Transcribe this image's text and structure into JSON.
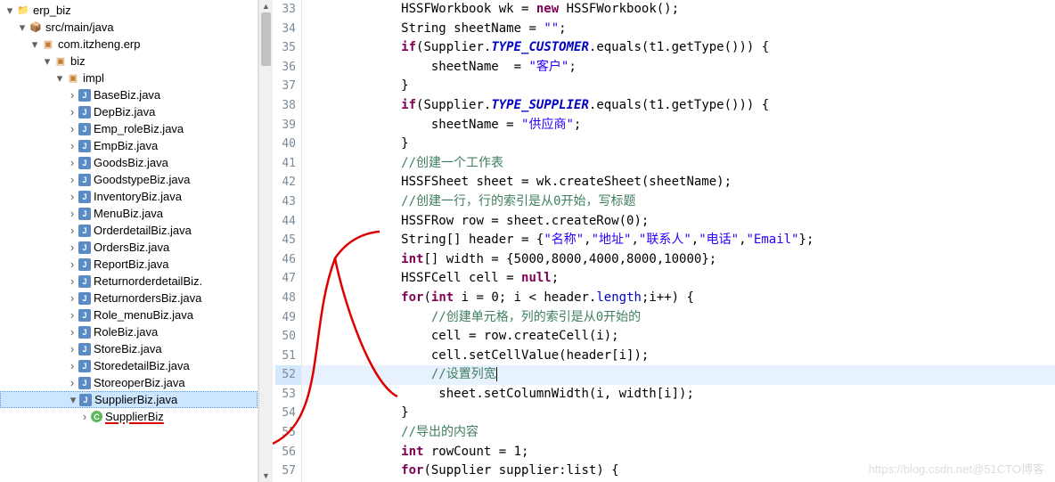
{
  "tree": {
    "root": "erp_biz",
    "src": "src/main/java",
    "pkg": "com.itzheng.erp",
    "biz": "biz",
    "impl": "impl",
    "files": [
      "BaseBiz.java",
      "DepBiz.java",
      "Emp_roleBiz.java",
      "EmpBiz.java",
      "GoodsBiz.java",
      "GoodstypeBiz.java",
      "InventoryBiz.java",
      "MenuBiz.java",
      "OrderdetailBiz.java",
      "OrdersBiz.java",
      "ReportBiz.java",
      "ReturnorderdetailBiz.",
      "ReturnordersBiz.java",
      "Role_menuBiz.java",
      "RoleBiz.java",
      "StoreBiz.java",
      "StoredetailBiz.java",
      "StoreoperBiz.java",
      "SupplierBiz.java"
    ],
    "class": "SupplierBiz"
  },
  "lines": {
    "start": 33,
    "highlight": 52
  },
  "code": {
    "l33": {
      "p1": "HSSFWorkbook wk = ",
      "kw": "new",
      "p2": " HSSFWorkbook();"
    },
    "l34": {
      "p1": "String sheetName = ",
      "s": "\"\"",
      "p2": ";"
    },
    "l35": {
      "kw": "if",
      "p1": "(Supplier.",
      "c": "TYPE_CUSTOMER",
      "p2": ".equals(t1.getType())) {"
    },
    "l36": {
      "p1": "    sheetName  = ",
      "s": "\"客户\"",
      "p2": ";"
    },
    "l37": {
      "p1": "}"
    },
    "l38": {
      "kw": "if",
      "p1": "(Supplier.",
      "c": "TYPE_SUPPLIER",
      "p2": ".equals(t1.getType())) {"
    },
    "l39": {
      "p1": "    sheetName = ",
      "s": "\"供应商\"",
      "p2": ";"
    },
    "l40": {
      "p1": "}"
    },
    "l41": {
      "cmt": "//创建一个工作表"
    },
    "l42": {
      "p1": "HSSFSheet sheet = wk.createSheet(sheetName);"
    },
    "l43": {
      "cmt": "//创建一行，行的索引是从0开始，写标题"
    },
    "l44": {
      "p1": "HSSFRow row = sheet.createRow(",
      "n": "0",
      "p2": ");"
    },
    "l45": {
      "p1": "String[] header = {",
      "s1": "\"名称\"",
      "c1": ",",
      "s2": "\"地址\"",
      "c2": ",",
      "s3": "\"联系人\"",
      "c3": ",",
      "s4": "\"电话\"",
      "c4": ",",
      "s5": "\"Email\"",
      "p2": "};"
    },
    "l46": {
      "kw": "int",
      "p1": "[] width = {",
      "n": "5000,8000,4000,8000,10000",
      "p2": "};"
    },
    "l47": {
      "p1": "HSSFCell cell = ",
      "kw": "null",
      "p2": ";"
    },
    "l48": {
      "kw1": "for",
      "p1": "(",
      "kw2": "int",
      "p2": " i = ",
      "n1": "0",
      "p3": "; i < header.",
      "fld": "length",
      "p4": ";i++) {"
    },
    "l49": {
      "cmt": "    //创建单元格，列的索引是从0开始的"
    },
    "l50": {
      "p1": "    cell = row.createCell(i);"
    },
    "l51": {
      "p1": "    cell.setCellValue(header[i]);"
    },
    "l52": {
      "cmt": "    //设置列宽"
    },
    "l53": {
      "p1": "    sheet.setColumnWidth(i, width[i]);"
    },
    "l54": {
      "p1": "}"
    },
    "l55": {
      "cmt": "//导出的内容"
    },
    "l56": {
      "kw": "int",
      "p1": " rowCount = ",
      "n": "1",
      "p2": ";"
    },
    "l57": {
      "kw": "for",
      "p1": "(Supplier supplier:list) {"
    }
  },
  "watermark": "https://blog.csdn.net@51CTO博客"
}
